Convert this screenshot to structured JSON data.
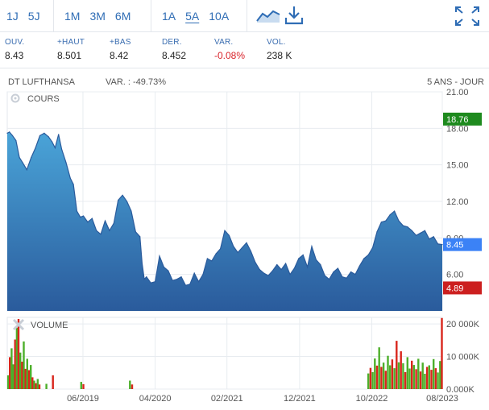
{
  "toolbar": {
    "periods_short": [
      "1J",
      "5J"
    ],
    "periods_mid": [
      "1M",
      "3M",
      "6M"
    ],
    "periods_long": [
      "1A",
      "5A",
      "10A"
    ],
    "active_period": "5A",
    "icons": [
      "area-chart-icon",
      "download-icon",
      "expand-icon"
    ]
  },
  "quote": [
    {
      "label": "OUV.",
      "value": "8.43"
    },
    {
      "label": "+HAUT",
      "value": "8.501"
    },
    {
      "label": "+BAS",
      "value": "8.42"
    },
    {
      "label": "DER.",
      "value": "8.452"
    },
    {
      "label": "VAR.",
      "value": "-0.08%"
    },
    {
      "label": "VOL.",
      "value": "238 K"
    }
  ],
  "chart_header": {
    "name": "DT LUFTHANSA",
    "variation": "VAR. : -49.73%",
    "range": "5 ANS - JOUR"
  },
  "colors": {
    "link": "#2f6db5",
    "area_top": "#4aa4d8",
    "area_bottom": "#2a5b9c",
    "line": "#2a5b9c",
    "max_badge": "#1e8a1e",
    "last_badge": "#3b82f6",
    "min_badge": "#cc1f1f",
    "vol_up": "#4caf2a",
    "vol_down": "#d9261c"
  },
  "chart_data": [
    {
      "type": "area",
      "panel_label": "COURS",
      "x_labels": [
        "06/2019",
        "04/2020",
        "02/2021",
        "12/2021",
        "10/2022",
        "08/2023"
      ],
      "x_positions": [
        0.174,
        0.34,
        0.505,
        0.672,
        0.838,
        1.0
      ],
      "y_ticks": [
        21.0,
        18.0,
        15.0,
        12.0,
        9.0,
        6.0
      ],
      "y_tick_labels": [
        "21.00",
        "18.00",
        "15.00",
        "12.00",
        "9.00",
        "6.00"
      ],
      "ylim": [
        3.0,
        21.0
      ],
      "badges": [
        {
          "label": "18.76",
          "value": 18.76,
          "kind": "max"
        },
        {
          "label": "8.45",
          "value": 8.45,
          "kind": "last"
        },
        {
          "label": "4.89",
          "value": 4.89,
          "kind": "min"
        }
      ],
      "x": [
        0,
        0.005,
        0.012,
        0.02,
        0.028,
        0.035,
        0.045,
        0.055,
        0.065,
        0.075,
        0.085,
        0.095,
        0.103,
        0.11,
        0.118,
        0.125,
        0.135,
        0.145,
        0.152,
        0.16,
        0.168,
        0.175,
        0.185,
        0.195,
        0.205,
        0.215,
        0.225,
        0.235,
        0.245,
        0.255,
        0.265,
        0.275,
        0.285,
        0.295,
        0.305,
        0.31,
        0.315,
        0.32,
        0.33,
        0.34,
        0.35,
        0.36,
        0.37,
        0.38,
        0.39,
        0.4,
        0.41,
        0.42,
        0.43,
        0.44,
        0.45,
        0.46,
        0.47,
        0.48,
        0.49,
        0.5,
        0.51,
        0.52,
        0.53,
        0.54,
        0.55,
        0.56,
        0.57,
        0.58,
        0.59,
        0.6,
        0.61,
        0.62,
        0.63,
        0.64,
        0.65,
        0.66,
        0.67,
        0.68,
        0.69,
        0.7,
        0.71,
        0.72,
        0.73,
        0.74,
        0.75,
        0.76,
        0.77,
        0.78,
        0.79,
        0.8,
        0.81,
        0.82,
        0.83,
        0.84,
        0.85,
        0.86,
        0.87,
        0.88,
        0.89,
        0.9,
        0.91,
        0.92,
        0.93,
        0.94,
        0.95,
        0.96,
        0.97,
        0.98,
        0.99,
        1.0
      ],
      "y": [
        17.6,
        17.7,
        17.4,
        17.0,
        15.6,
        15.2,
        14.6,
        15.6,
        16.4,
        17.4,
        17.6,
        17.3,
        16.9,
        16.4,
        17.5,
        16.3,
        15.2,
        13.9,
        13.4,
        11.2,
        10.7,
        10.8,
        10.3,
        10.6,
        9.6,
        9.3,
        10.4,
        9.6,
        10.2,
        12.1,
        12.5,
        12.0,
        11.2,
        9.5,
        9.1,
        6.9,
        5.6,
        5.8,
        5.3,
        5.4,
        7.5,
        6.6,
        6.3,
        5.5,
        5.6,
        5.8,
        5.1,
        5.2,
        6.1,
        5.4,
        6.0,
        7.3,
        7.1,
        7.7,
        8.1,
        9.6,
        9.2,
        8.3,
        7.8,
        8.2,
        8.6,
        7.9,
        7.0,
        6.4,
        6.1,
        5.9,
        6.3,
        6.8,
        6.4,
        6.9,
        6.0,
        6.5,
        7.3,
        7.6,
        6.6,
        8.3,
        7.2,
        6.8,
        5.9,
        5.6,
        6.2,
        6.5,
        5.8,
        5.7,
        6.2,
        6.0,
        6.7,
        7.3,
        7.6,
        8.2,
        9.5,
        10.3,
        10.4,
        10.9,
        11.2,
        10.4,
        10.0,
        9.9,
        9.6,
        9.2,
        9.4,
        9.6,
        8.9,
        9.1,
        8.5,
        8.45
      ]
    },
    {
      "type": "bar",
      "panel_label": "VOLUME",
      "y_ticks": [
        20000,
        10000,
        0
      ],
      "y_tick_labels": [
        "20 000K",
        "10 000K",
        "0.000K"
      ],
      "ylim": [
        0,
        22000
      ],
      "x": [
        0.002,
        0.006,
        0.01,
        0.014,
        0.018,
        0.022,
        0.026,
        0.03,
        0.034,
        0.038,
        0.042,
        0.046,
        0.05,
        0.054,
        0.058,
        0.062,
        0.066,
        0.07,
        0.074,
        0.09,
        0.105,
        0.17,
        0.175,
        0.282,
        0.287,
        0.83,
        0.835,
        0.84,
        0.845,
        0.85,
        0.855,
        0.86,
        0.865,
        0.87,
        0.875,
        0.88,
        0.885,
        0.89,
        0.895,
        0.9,
        0.905,
        0.91,
        0.915,
        0.92,
        0.925,
        0.93,
        0.935,
        0.94,
        0.945,
        0.95,
        0.955,
        0.96,
        0.965,
        0.97,
        0.975,
        0.98,
        0.985,
        0.99,
        0.995,
        0.999
      ],
      "values": [
        4200,
        9800,
        12500,
        7600,
        15200,
        18800,
        21500,
        11200,
        8400,
        14600,
        6200,
        9300,
        5800,
        7400,
        3600,
        2600,
        1800,
        3100,
        1400,
        1600,
        4200,
        2200,
        1500,
        2600,
        1400,
        4800,
        6500,
        5200,
        9400,
        7200,
        12800,
        6800,
        8100,
        5600,
        10200,
        7300,
        9100,
        6400,
        14800,
        8200,
        11600,
        7900,
        5200,
        9800,
        6300,
        8700,
        7400,
        6100,
        9300,
        5400,
        8100,
        4700,
        6800,
        7300,
        5900,
        9200,
        6400,
        5100,
        8600,
        21800
      ],
      "up": [
        true,
        false,
        true,
        true,
        false,
        true,
        false,
        true,
        false,
        true,
        false,
        true,
        false,
        true,
        false,
        true,
        false,
        true,
        false,
        true,
        false,
        true,
        false,
        true,
        false,
        true,
        false,
        true,
        true,
        false,
        true,
        false,
        true,
        false,
        true,
        true,
        false,
        true,
        false,
        true,
        false,
        true,
        false,
        true,
        true,
        false,
        true,
        false,
        true,
        false,
        true,
        true,
        false,
        true,
        false,
        true,
        false,
        true,
        true,
        false
      ]
    }
  ]
}
